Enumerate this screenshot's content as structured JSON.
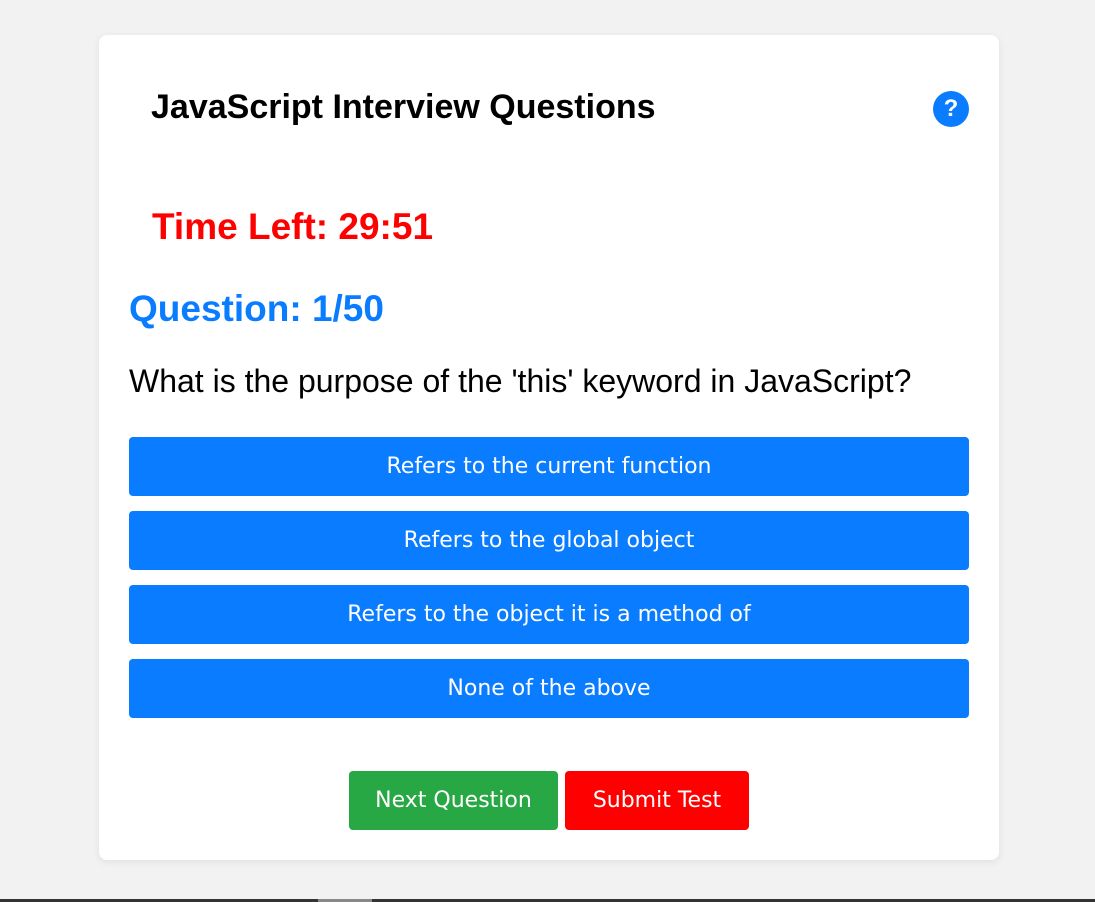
{
  "quiz": {
    "title": "JavaScript Interview Questions",
    "help_icon": "?",
    "timer": "Time Left: 29:51",
    "question_counter": "Question: 1/50",
    "question_text": "What is the purpose of the 'this' keyword in JavaScript?",
    "options": [
      "Refers to the current function",
      "Refers to the global object",
      "Refers to the object it is a method of",
      "None of the above"
    ],
    "next_label": "Next Question",
    "submit_label": "Submit Test"
  },
  "colors": {
    "accent": "#0a7cff",
    "timer": "#ff0000",
    "next": "#28a745",
    "submit": "#ff0000",
    "background": "#f2f2f2",
    "card": "#ffffff"
  },
  "icons": {
    "help": "question-circle-icon"
  }
}
